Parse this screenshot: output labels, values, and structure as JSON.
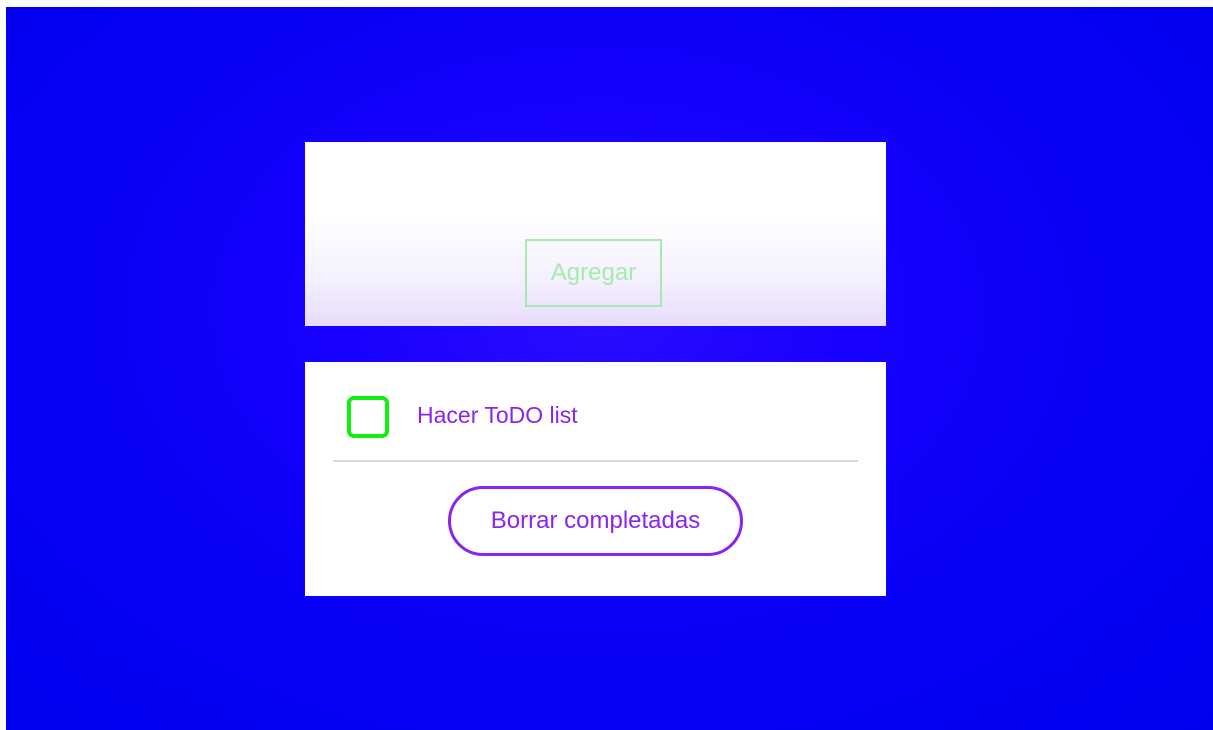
{
  "form": {
    "add_label": "Agregar"
  },
  "todo": {
    "items": [
      {
        "text": "Hacer ToDO list",
        "completed": false
      }
    ],
    "clear_label": "Borrar completadas"
  },
  "colors": {
    "background": "#0800f5",
    "accent_purple": "#8a24f0",
    "checkbox_green": "#11ee11",
    "add_button_green": "#a4ecab"
  }
}
